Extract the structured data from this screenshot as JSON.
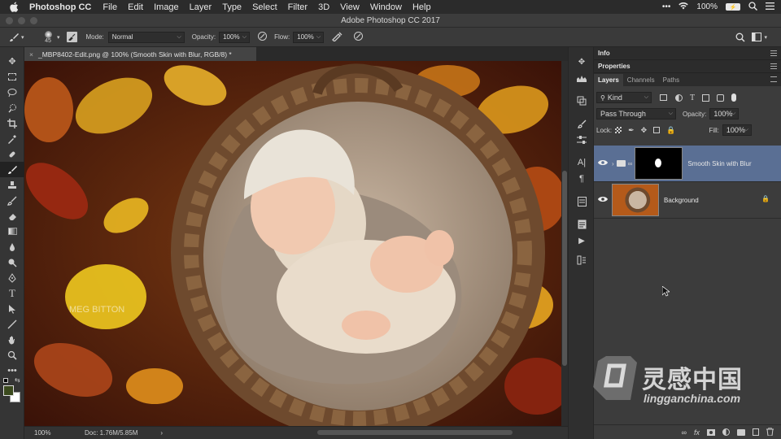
{
  "menubar": {
    "app_name": "Photoshop CC",
    "items": [
      "File",
      "Edit",
      "Image",
      "Layer",
      "Type",
      "Select",
      "Filter",
      "3D",
      "View",
      "Window",
      "Help"
    ],
    "battery": "100%",
    "battery_icon_text": "⚡"
  },
  "window": {
    "title": "Adobe Photoshop CC 2017"
  },
  "options": {
    "brush_size": "45",
    "mode_label": "Mode:",
    "mode_value": "Normal",
    "opacity_label": "Opacity:",
    "opacity_value": "100%",
    "flow_label": "Flow:",
    "flow_value": "100%"
  },
  "document": {
    "close_glyph": "×",
    "tab_title": "_MBP8402-Edit.png @ 100% (Smooth Skin with Blur, RGB/8) *",
    "zoom": "100%",
    "doc_info": "Doc: 1.76M/5.85M",
    "status_arrow": "›",
    "photo_watermark": "MEG BITTON"
  },
  "panels": {
    "info": "Info",
    "properties": "Properties",
    "tabs": [
      "Layers",
      "Channels",
      "Paths"
    ],
    "filter_kind": "Kind",
    "blend_mode": "Pass Through",
    "opacity_label": "Opacity:",
    "opacity_value": "100%",
    "lock_label": "Lock:",
    "fill_label": "Fill:",
    "fill_value": "100%",
    "layers": [
      {
        "name": "Smooth Skin with Blur",
        "selected": true
      },
      {
        "name": "Background",
        "selected": false
      }
    ],
    "bottom_fx": "fx"
  },
  "watermark": {
    "cn": "灵感中国",
    "url": "lingganchina.com"
  },
  "colors": {
    "selected_layer": "#5a6f94",
    "panel_bg": "#3c3c3c",
    "foreground": "#3b4a1e",
    "background": "#ffffff"
  }
}
